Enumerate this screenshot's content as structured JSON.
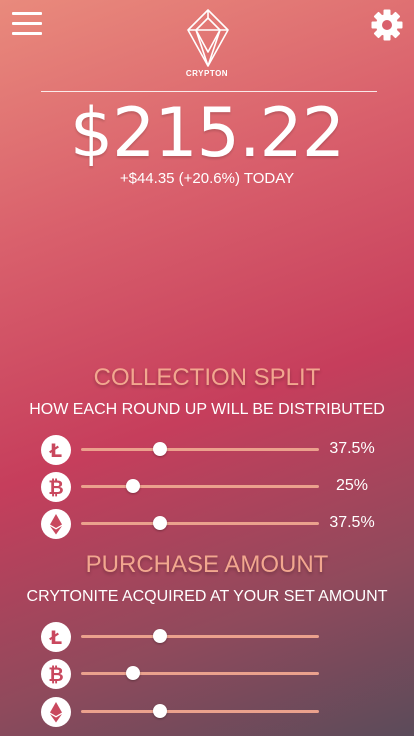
{
  "app": {
    "logo_text": "CRYPTON"
  },
  "icons": {
    "menu": "hamburger-menu-icon",
    "settings": "gear-icon",
    "logo": "diamond-logo-icon"
  },
  "balance": {
    "amount": "$215.22",
    "change": "+$44.35 (+20.6%) TODAY"
  },
  "collection_split": {
    "title": "COLLECTION SPLIT",
    "subtitle": "HOW EACH ROUND UP WILL BE DISTRIBUTED",
    "items": [
      {
        "coin": "litecoin-icon",
        "value": 0.33,
        "label": "37.5%"
      },
      {
        "coin": "bitcoin-icon",
        "value": 0.22,
        "label": "25%"
      },
      {
        "coin": "ethereum-icon",
        "value": 0.33,
        "label": "37.5%"
      }
    ]
  },
  "purchase_amount": {
    "title": "PURCHASE AMOUNT",
    "subtitle": "CRYTONITE ACQUIRED AT YOUR SET AMOUNT",
    "items": [
      {
        "coin": "litecoin-icon",
        "value": 0.33
      },
      {
        "coin": "bitcoin-icon",
        "value": 0.22
      },
      {
        "coin": "ethereum-icon",
        "value": 0.33
      }
    ]
  },
  "colors": {
    "accent": "#f2a78f",
    "track": "#eba18d",
    "coin_icon": "#c9485e"
  }
}
